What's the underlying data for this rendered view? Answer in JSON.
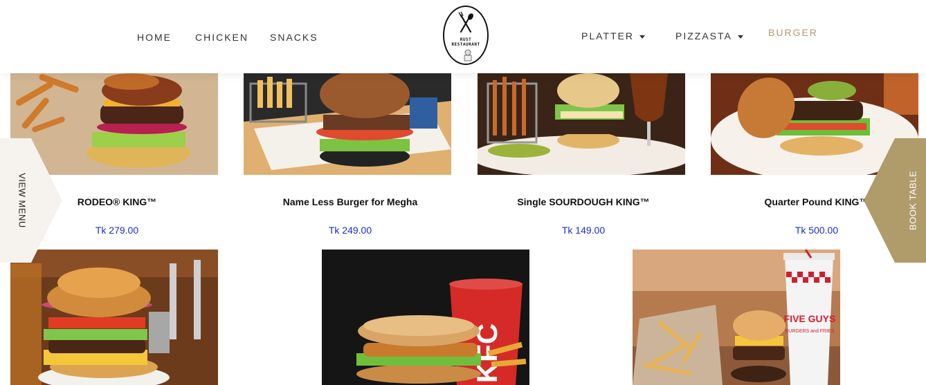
{
  "nav": {
    "left": [
      {
        "label": "HOME"
      },
      {
        "label": "CHICKEN"
      },
      {
        "label": "SNACKS"
      }
    ],
    "right": [
      {
        "label": "PLATTER",
        "dropdown": true
      },
      {
        "label": "PIZZASTA",
        "dropdown": true
      },
      {
        "label": "BURGER",
        "active": true
      }
    ],
    "logo": {
      "line1": "RUST",
      "line2": "RESTAURANT"
    }
  },
  "side": {
    "left_label": "VIEW MENU",
    "right_label": "BOOK TABLE"
  },
  "products": [
    {
      "title": "RODEO® KING™",
      "price": "Tk 279.00"
    },
    {
      "title": "Name Less Burger for Megha",
      "price": "Tk 249.00"
    },
    {
      "title": "Single SOURDOUGH KING™",
      "price": "Tk 149.00"
    },
    {
      "title": "Quarter Pound KING™",
      "price": "Tk 500.00"
    }
  ],
  "image_texts": {
    "kfc": "KFC",
    "fiveguys": "FIVE GUYS",
    "fiveguys_sub": "BURGERS and FRIES"
  },
  "colors": {
    "accent": "#b09b6a",
    "price": "#1a2bd1",
    "side_left_bg": "#f6f3ee"
  }
}
